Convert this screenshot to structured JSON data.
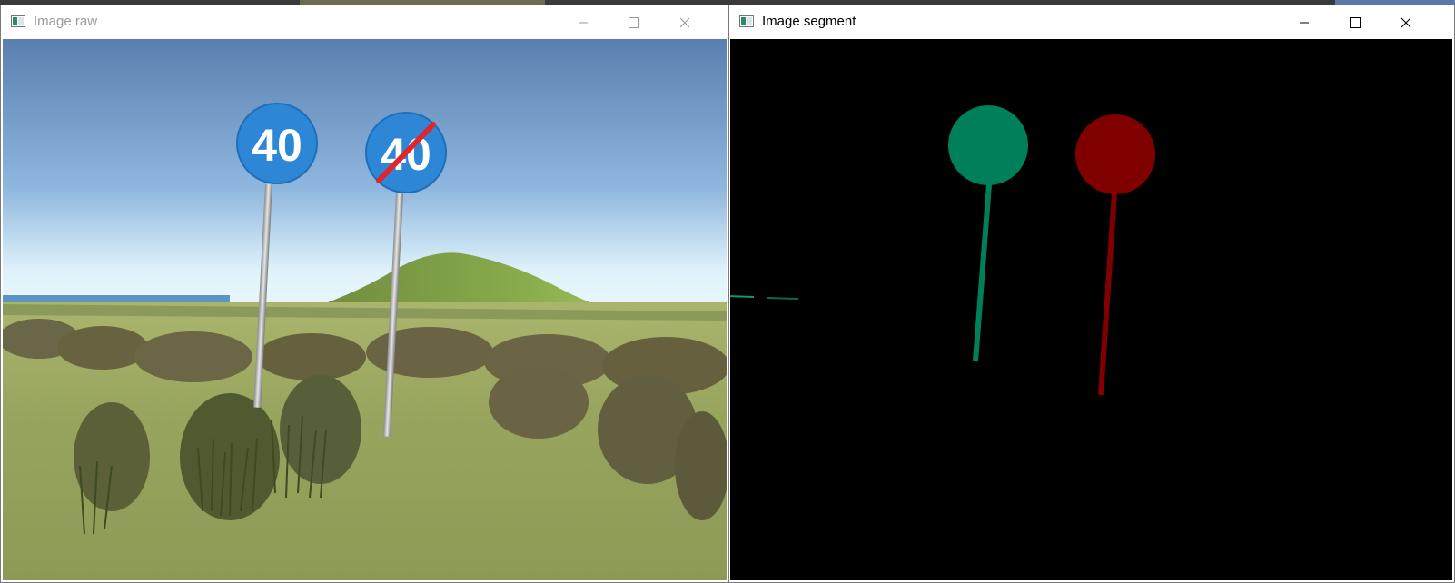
{
  "windows": [
    {
      "title": "Image raw",
      "icon": "opencv-window-icon",
      "controls": [
        "minimize-icon",
        "maximize-icon",
        "close-icon"
      ],
      "image": {
        "description_kind": "rendered-scene",
        "signs": [
          {
            "text": "40",
            "type": "minimum-speed",
            "color": "#2d86d6"
          },
          {
            "text": "40",
            "type": "end-of-minimum-speed",
            "color": "#2d86d6",
            "strike_color": "#e0262d"
          }
        ]
      }
    },
    {
      "title": "Image segment",
      "icon": "opencv-window-icon",
      "controls": [
        "minimize-icon",
        "maximize-icon",
        "close-icon"
      ],
      "image": {
        "background": "#000000",
        "segments": [
          {
            "class_color": "#00805a"
          },
          {
            "class_color": "#800000"
          }
        ]
      }
    }
  ],
  "colors": {
    "sky_top": "#5a7fb0",
    "sky_bottom": "#dff2fb",
    "grass": "#94a45a",
    "sign_blue": "#2d86d6",
    "segment_green": "#00805a",
    "segment_red": "#800000"
  }
}
